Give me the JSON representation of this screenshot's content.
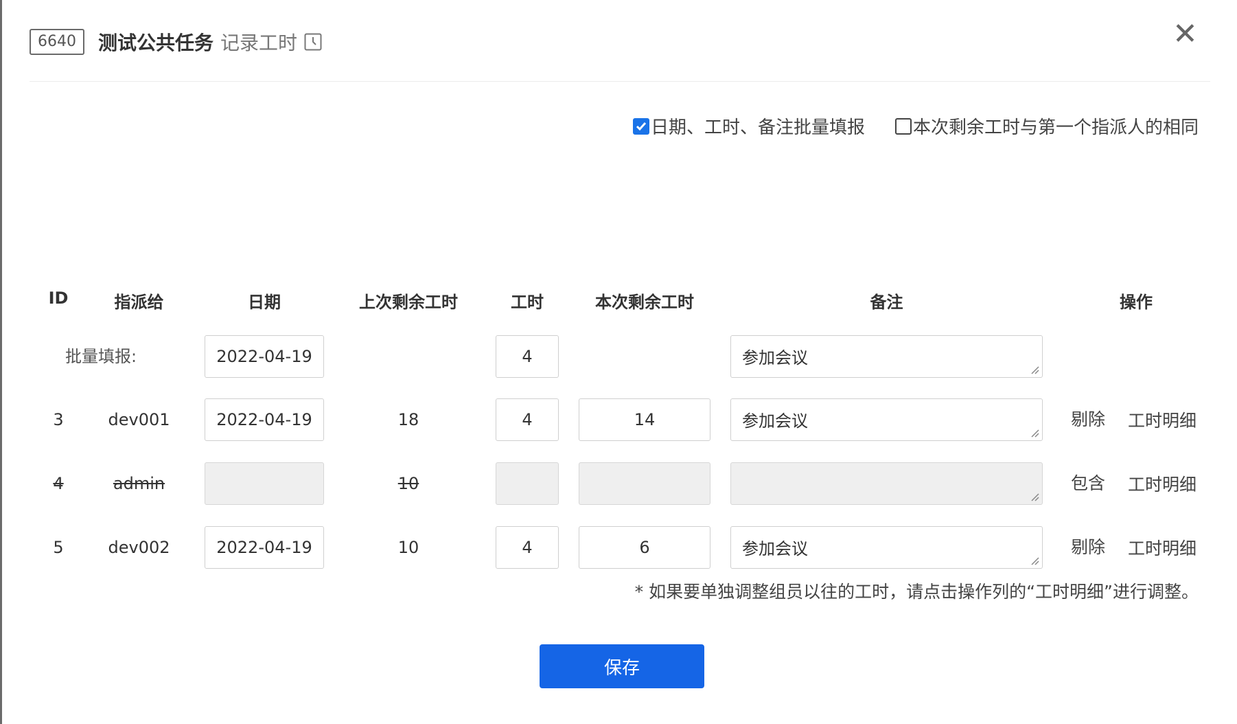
{
  "header": {
    "task_id": "6640",
    "task_title": "测试公共任务",
    "action_name": "记录工时"
  },
  "options": {
    "batch_fill": {
      "label": "日期、工时、备注批量填报",
      "checked": true
    },
    "same_remaining": {
      "label": "本次剩余工时与第一个指派人的相同",
      "checked": false
    }
  },
  "table": {
    "columns": [
      "ID",
      "指派给",
      "日期",
      "上次剩余工时",
      "工时",
      "本次剩余工时",
      "备注",
      "操作"
    ],
    "batch_row": {
      "label": "批量填报:",
      "date": "2022-04-19",
      "hours": "4",
      "remark": "参加会议"
    },
    "rows": [
      {
        "id": "3",
        "assignee": "dev001",
        "date": "2022-04-19",
        "last_remaining": "18",
        "hours": "4",
        "remaining": "14",
        "remark": "参加会议",
        "action1": "剔除",
        "action2": "工时明细",
        "disabled": false
      },
      {
        "id": "4",
        "assignee": "admin",
        "date": "",
        "last_remaining": "10",
        "hours": "",
        "remaining": "",
        "remark": "",
        "action1": "包含",
        "action2": "工时明细",
        "disabled": true
      },
      {
        "id": "5",
        "assignee": "dev002",
        "date": "2022-04-19",
        "last_remaining": "10",
        "hours": "4",
        "remaining": "6",
        "remark": "参加会议",
        "action1": "剔除",
        "action2": "工时明细",
        "disabled": false
      }
    ]
  },
  "note": "* 如果要单独调整组员以往的工时，请点击操作列的“工时明细”进行调整。",
  "save_label": "保存",
  "colors": {
    "primary": "#1565e6",
    "disabled_bg": "#efefef",
    "border": "#cfcfcf"
  },
  "icons": {
    "close": "close-icon",
    "clock": "clock-icon",
    "check": "check-icon"
  }
}
